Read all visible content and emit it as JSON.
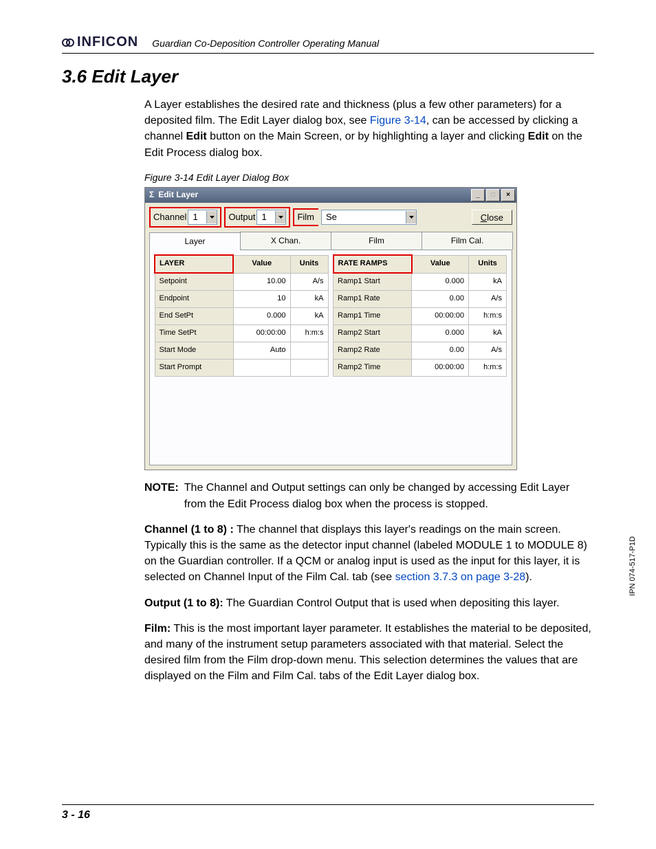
{
  "header": {
    "company": "INFICON",
    "doc_title": "Guardian Co-Deposition Controller Operating Manual"
  },
  "section": {
    "number": "3.6",
    "title": "Edit Layer"
  },
  "intro": {
    "p1a": "A Layer establishes the desired rate and thickness (plus a few other parameters) for a deposited film. The Edit Layer dialog box, see ",
    "fig_link": "Figure 3-14",
    "p1b": ", can be accessed by clicking a channel ",
    "bold1": "Edit",
    "p1c": " button on the Main Screen, or by highlighting a layer and clicking ",
    "bold2": "Edit",
    "p1d": " on the Edit Process dialog box."
  },
  "figure_caption": "Figure 3-14  Edit Layer Dialog Box",
  "dialog": {
    "sigma": "Σ",
    "title": "Edit Layer",
    "channel_label": "Channel",
    "channel_value": "1",
    "output_label": "Output",
    "output_value": "1",
    "film_label": "Film",
    "film_value": "Se",
    "close": "lose",
    "close_u": "C",
    "tabs": [
      "Layer",
      "X Chan.",
      "Film",
      "Film Cal."
    ],
    "left": {
      "header": [
        "LAYER",
        "Value",
        "Units"
      ],
      "rows": [
        {
          "l": "Setpoint",
          "v": "10.00",
          "u": "A/s"
        },
        {
          "l": "Endpoint",
          "v": "10",
          "u": "kA"
        },
        {
          "l": "End SetPt",
          "v": "0.000",
          "u": "kA"
        },
        {
          "l": "Time SetPt",
          "v": "00:00:00",
          "u": "h:m:s"
        },
        {
          "l": "Start Mode",
          "v": "Auto",
          "u": ""
        },
        {
          "l": "Start Prompt",
          "v": "",
          "u": ""
        }
      ]
    },
    "right": {
      "header": [
        "RATE RAMPS",
        "Value",
        "Units"
      ],
      "rows": [
        {
          "l": "Ramp1 Start",
          "v": "0.000",
          "u": "kA"
        },
        {
          "l": "Ramp1 Rate",
          "v": "0.00",
          "u": "A/s"
        },
        {
          "l": "Ramp1 Time",
          "v": "00:00:00",
          "u": "h:m:s"
        },
        {
          "l": "Ramp2 Start",
          "v": "0.000",
          "u": "kA"
        },
        {
          "l": "Ramp2 Rate",
          "v": "0.00",
          "u": "A/s"
        },
        {
          "l": "Ramp2 Time",
          "v": "00:00:00",
          "u": "h:m:s"
        }
      ]
    }
  },
  "note": {
    "label": "NOTE:",
    "text": "The Channel and Output settings can only be changed by accessing Edit Layer from the Edit Process dialog box when the process is stopped."
  },
  "para_channel": {
    "b": "Channel (1 to 8) :",
    "t1": " The channel that displays this layer's readings on the main screen. Typically this is the same as the detector input channel (labeled MODULE 1 to MODULE 8) on the Guardian controller. If a QCM or analog input is used as the input for this layer, it is selected on Channel Input of the Film Cal. tab (see ",
    "link": "section 3.7.3 on page 3-28",
    "t2": ")."
  },
  "para_output": {
    "b": "Output (1 to 8):",
    "t": " The Guardian Control Output that is used when depositing this layer."
  },
  "para_film": {
    "b": "Film:",
    "t": " This is the most important layer parameter. It establishes the material to be deposited, and many of the instrument setup parameters associated with that material. Select the desired film from the Film drop-down menu. This selection determines the values that are displayed on the Film and Film Cal. tabs of the Edit Layer dialog box."
  },
  "ipn": "IPN 074-517-P1D",
  "footer": "3 - 16"
}
